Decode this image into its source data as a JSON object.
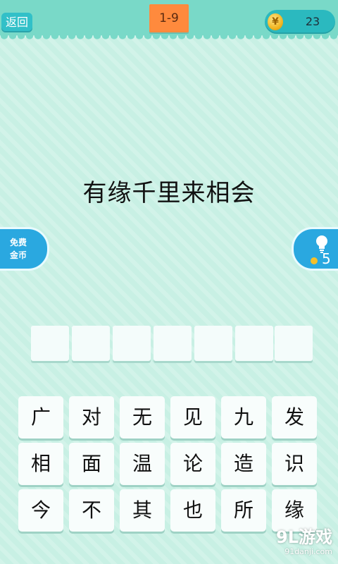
{
  "header": {
    "back_label": "返回",
    "level": "1-9",
    "coins": "23",
    "coin_glyph": "¥"
  },
  "puzzle": {
    "idiom": "有缘千里来相会"
  },
  "side": {
    "free_coins_line1": "免费",
    "free_coins_line2": "金币",
    "hint_count": "5"
  },
  "answer_slots": [
    "",
    "",
    "",
    "",
    "",
    "",
    ""
  ],
  "keyboard": [
    [
      "广",
      "对",
      "无",
      "见",
      "九",
      "发"
    ],
    [
      "相",
      "面",
      "温",
      "论",
      "造",
      "识"
    ],
    [
      "今",
      "不",
      "其",
      "也",
      "所",
      "缘"
    ]
  ],
  "watermark": {
    "main": "9L游戏",
    "sub": "91danji.com"
  },
  "colors": {
    "background": "#c8f0e4",
    "topbar": "#79d9c8",
    "level_badge": "#ff8a3d",
    "button_teal": "#32c0c8",
    "side_blue": "#2aa8e0"
  }
}
